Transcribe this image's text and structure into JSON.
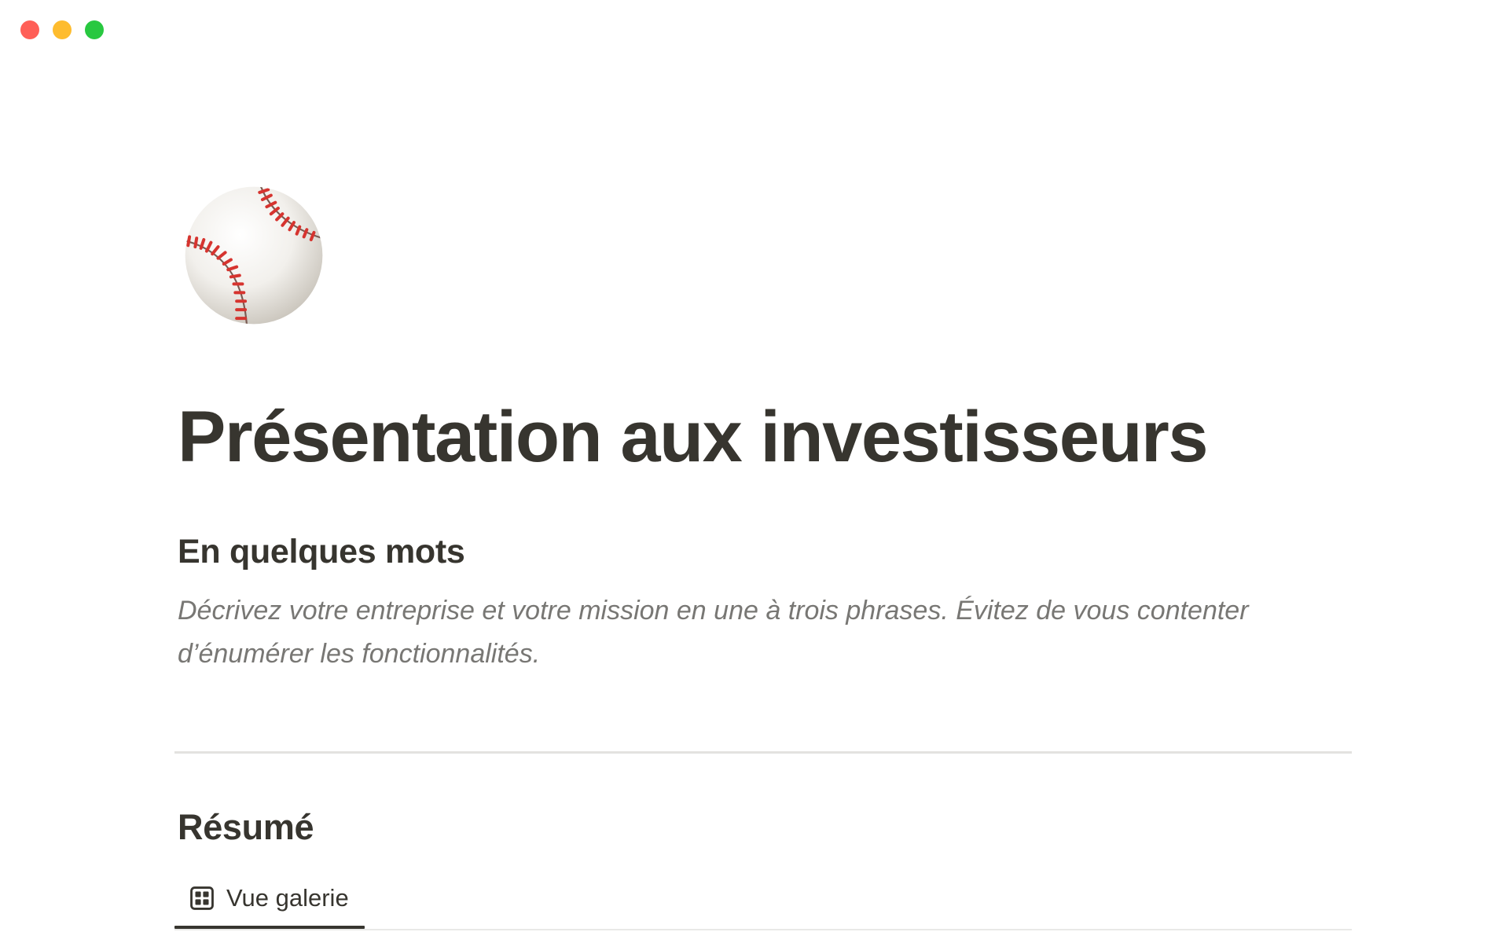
{
  "window": {
    "controls": [
      {
        "name": "close",
        "color": "#ff5f57"
      },
      {
        "name": "minimize",
        "color": "#febc2e"
      },
      {
        "name": "zoom",
        "color": "#28c840"
      }
    ]
  },
  "page": {
    "icon": "baseball-icon",
    "title": "Présentation aux investisseurs",
    "sections": {
      "mots": {
        "heading": "En quelques mots",
        "description": "Décrivez votre entreprise et votre mission en une à trois phrases. Évitez de vous contenter d’énumérer les fonctionnalités."
      },
      "resume": {
        "heading": "Résumé",
        "view_tab": {
          "icon": "gallery-icon",
          "label": "Vue galerie"
        }
      }
    }
  },
  "colors": {
    "text": "#37352f",
    "muted_text": "#787774",
    "divider": "#e3e2e0"
  }
}
